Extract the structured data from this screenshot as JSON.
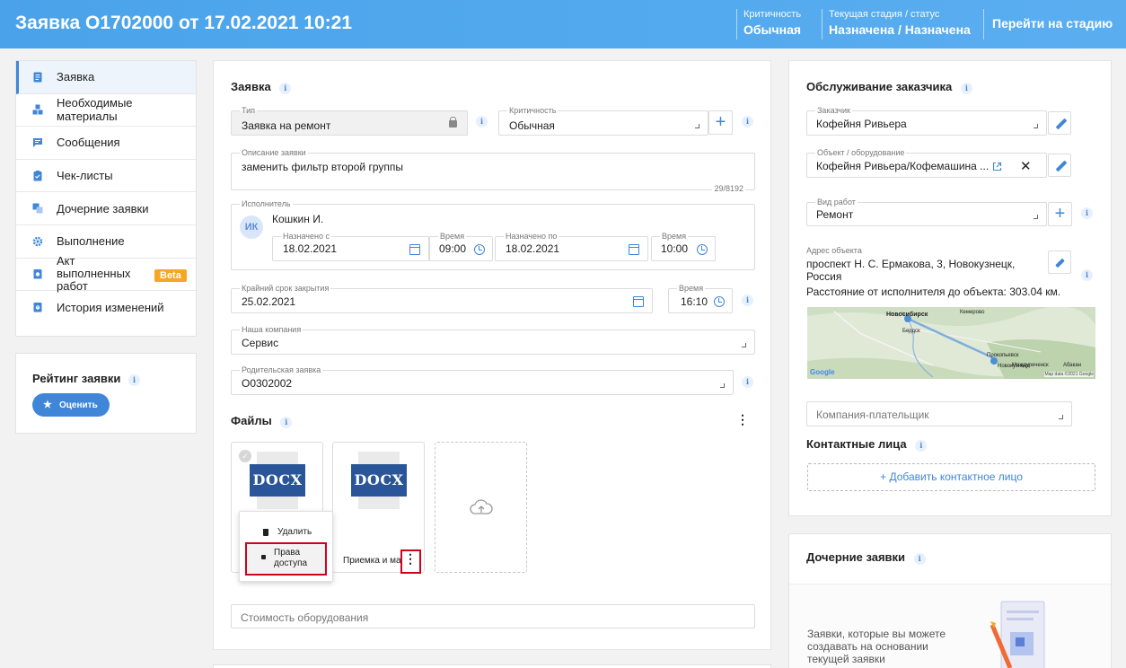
{
  "header": {
    "title": "Заявка O1702000 от 17.02.2021 10:21",
    "criticality_label": "Критичность",
    "criticality_value": "Обычная",
    "stage_label": "Текущая стадия / статус",
    "stage_value": "Назначена / Назначена",
    "goto_stage": "Перейти на стадию"
  },
  "nav": {
    "items": [
      {
        "label": "Заявка",
        "icon": "document-icon"
      },
      {
        "label": "Необходимые материалы",
        "icon": "boxes-icon"
      },
      {
        "label": "Сообщения",
        "icon": "message-icon"
      },
      {
        "label": "Чек-листы",
        "icon": "checklist-icon"
      },
      {
        "label": "Дочерние заявки",
        "icon": "child-requests-icon"
      },
      {
        "label": "Выполнение",
        "icon": "gear-icon"
      },
      {
        "label": "Акт выполненных работ",
        "icon": "act-icon",
        "badge": "Beta"
      },
      {
        "label": "История изменений",
        "icon": "history-icon"
      }
    ]
  },
  "rating": {
    "title": "Рейтинг заявки",
    "button": "Оценить"
  },
  "request": {
    "section_title": "Заявка",
    "type_label": "Тип",
    "type_value": "Заявка на ремонт",
    "criticality_label": "Критичность",
    "criticality_value": "Обычная",
    "description_label": "Описание заявки",
    "description_value": "заменить фильтр второй группы",
    "description_counter": "29/8192",
    "executor_label": "Исполнитель",
    "executor_initials": "ИК",
    "executor_name": "Кошкин И.",
    "assigned_from_label": "Назначено с",
    "assigned_from_value": "18.02.2021",
    "time1_label": "Время",
    "time1_value": "09:00",
    "assigned_to_label": "Назначено по",
    "assigned_to_value": "18.02.2021",
    "time2_label": "Время",
    "time2_value": "10:00",
    "deadline_label": "Крайний срок закрытия",
    "deadline_value": "25.02.2021",
    "time3_label": "Время",
    "time3_value": "16:10",
    "company_label": "Наша компания",
    "company_value": "Сервис",
    "parent_label": "Родительская заявка",
    "parent_value": "O0302002",
    "files_title": "Файлы",
    "file1_type": "DOCX",
    "file2_type": "DOCX",
    "file2_name": "Приемка и ма",
    "menu_delete": "Удалить",
    "menu_rights_1": "Права",
    "menu_rights_2": "доступа",
    "cost_placeholder": "Стоимость оборудования"
  },
  "customer": {
    "section_title": "Обслуживание заказчика",
    "customer_label": "Заказчик",
    "customer_value": "Кофейня Ривьера",
    "object_label": "Объект / оборудование",
    "object_value": "Кофейня Ривьера/Кофемашина ...",
    "work_label": "Вид работ",
    "work_value": "Ремонт",
    "address_label": "Адрес объекта",
    "address_line1": "проспект Н. С. Ермакова, 3, Новокузнецк,",
    "address_line2": "Россия",
    "distance": "Расстояние от исполнителя до объекта: 303.04 км.",
    "map_city1": "Новосибирск",
    "map_city2": "Прокопьевск",
    "map_city3": "Новокузнецк",
    "map_label_kemerovo": "Кемерово",
    "map_label_berdsk": "Бердск",
    "map_label_abakan": "Абакан",
    "map_label_mezhdurechensk": "Междуреченск",
    "map_google": "Google",
    "map_credits": "Map data ©2021 Google",
    "payer_placeholder": "Компания-плательщик",
    "contacts_title": "Контактные лица",
    "add_contact": "+ Добавить контактное лицо"
  },
  "child": {
    "title": "Дочерние заявки",
    "text": "Заявки, которые вы можете создавать на основании текущей заявки"
  },
  "colors": {
    "accent": "#3f86d9",
    "header": "#4aa3ea",
    "beta": "#f6a623",
    "highlight": "#d0021b"
  }
}
